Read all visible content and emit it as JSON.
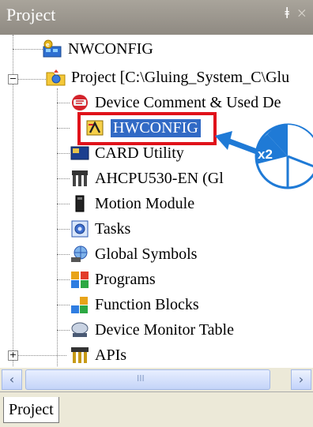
{
  "panel": {
    "title": "Project",
    "pin_glyph": "ǂ",
    "close_glyph": "×"
  },
  "tree": {
    "items": [
      {
        "label": "NWCONFIG",
        "icon": "network-config-icon"
      },
      {
        "label": "Project [C:\\Gluing_System_C\\Glu",
        "icon": "project-folder-icon"
      },
      {
        "label": "Device Comment & Used De",
        "icon": "device-comment-icon"
      },
      {
        "label": "HWCONFIG",
        "icon": "hwconfig-icon"
      },
      {
        "label": "CARD Utility",
        "icon": "card-utility-icon"
      },
      {
        "label": "AHCPU530-EN  (Gl",
        "icon": "cpu-module-icon"
      },
      {
        "label": "Motion Module",
        "icon": "motion-module-icon"
      },
      {
        "label": "Tasks",
        "icon": "tasks-icon"
      },
      {
        "label": "Global Symbols",
        "icon": "global-symbols-icon"
      },
      {
        "label": "Programs",
        "icon": "programs-icon"
      },
      {
        "label": "Function Blocks",
        "icon": "function-blocks-icon"
      },
      {
        "label": "Device Monitor Table",
        "icon": "device-monitor-icon"
      },
      {
        "label": "APIs",
        "icon": "apis-icon"
      }
    ],
    "expand_minus": "−",
    "expand_plus": "+"
  },
  "scrollbar": {
    "left_arrow": "‹",
    "right_arrow": "›",
    "grip": "III"
  },
  "bottom_tab": {
    "label": "Project"
  },
  "annotation": {
    "badge_text": "x2",
    "badge_color": "#1f7ad6"
  },
  "colors": {
    "selection": "#316ac5",
    "highlight_border": "#e0121a",
    "titlebar": "#9c978f"
  }
}
